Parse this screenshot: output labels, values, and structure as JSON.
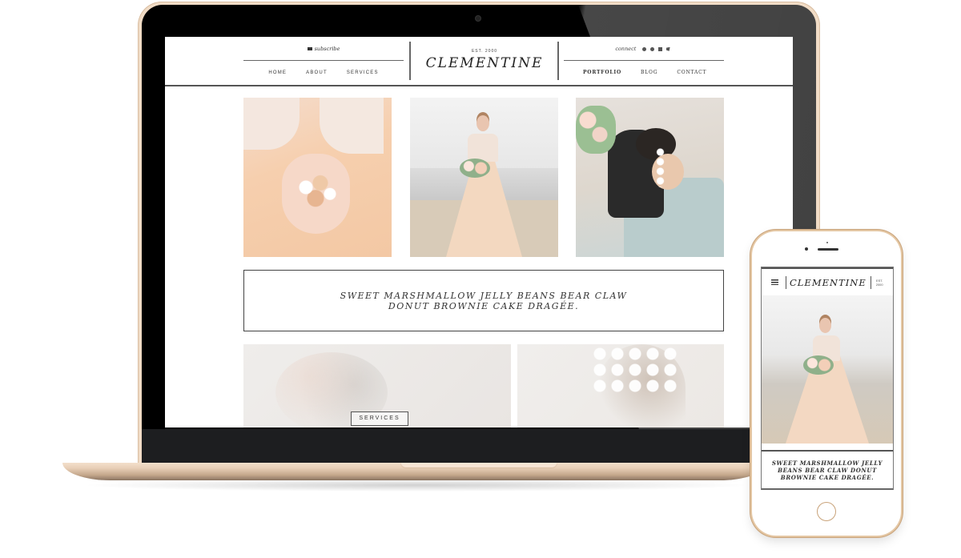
{
  "laptop": {
    "site": {
      "header": {
        "subscribe_label": "subscribe",
        "nav_left": [
          {
            "label": "HOME"
          },
          {
            "label": "ABOUT"
          },
          {
            "label": "SERVICES"
          }
        ],
        "est_label": "EST. 2000",
        "logo": "CLEMENTINE",
        "connect_label": "connect",
        "social_icons": [
          "instagram-icon",
          "pinterest-icon",
          "facebook-icon",
          "twitter-icon"
        ],
        "nav_right": [
          {
            "label": "PORTFOLIO"
          },
          {
            "label": "BLOG"
          },
          {
            "label": "CONTACT"
          }
        ]
      },
      "gallery": [
        {
          "alt": "Hands holding seashells over peach tulle dress"
        },
        {
          "alt": "Bride in peach tulle gown on beach holding bouquet"
        },
        {
          "alt": "Couple embracing on sand, bride in blue tulle"
        }
      ],
      "quote": "SWEET MARSHMALLOW JELLY BEANS BEAR CLAW DONUT BROWNIE CAKE DRAGÉE.",
      "tiles": [
        {
          "alt": "Faded couple photo with script overlay",
          "button_label": "SERVICES"
        },
        {
          "alt": "Faded bride profile with floral crown"
        }
      ]
    }
  },
  "phone": {
    "site": {
      "logo": "CLEMENTINE",
      "est_line1": "EST.",
      "est_line2": "2000",
      "photo_alt": "Bride in peach tulle gown on beach holding bouquet",
      "quote": "SWEET MARSHMALLOW JELLY BEANS BEAR CLAW DONUT BROWNIE CAKE DRAGÉE."
    }
  },
  "colors": {
    "device_gold": "#e4c7a4",
    "text_dark": "#333333",
    "border_gray": "#555555"
  }
}
